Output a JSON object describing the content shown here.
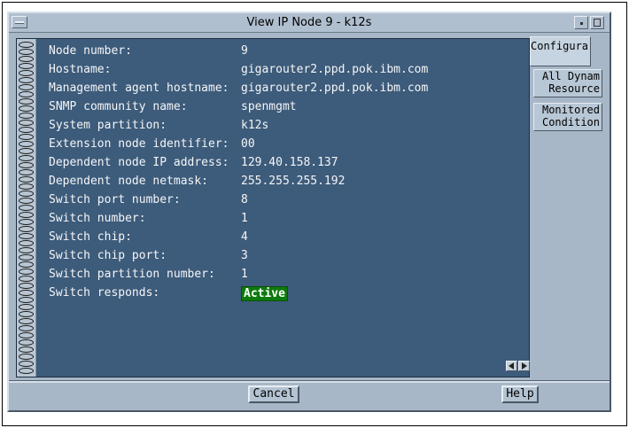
{
  "window": {
    "title": "View IP Node 9 - k12s"
  },
  "fields": [
    {
      "label": "Node number:",
      "value": "9"
    },
    {
      "label": "Hostname:",
      "value": "gigarouter2.ppd.pok.ibm.com"
    },
    {
      "label": "Management agent hostname:",
      "value": "gigarouter2.ppd.pok.ibm.com"
    },
    {
      "label": "SNMP community name:",
      "value": "spenmgmt"
    },
    {
      "label": "System partition:",
      "value": "k12s"
    },
    {
      "label": "Extension node identifier:",
      "value": "00"
    },
    {
      "label": "Dependent node IP address:",
      "value": "129.40.158.137"
    },
    {
      "label": "Dependent node netmask:",
      "value": "255.255.255.192"
    },
    {
      "label": "Switch port number:",
      "value": "8"
    },
    {
      "label": "Switch number:",
      "value": "1"
    },
    {
      "label": "Switch chip:",
      "value": "4"
    },
    {
      "label": "Switch chip port:",
      "value": "3"
    },
    {
      "label": "Switch partition number:",
      "value": "1"
    },
    {
      "label": "Switch responds:",
      "value": "Active"
    }
  ],
  "status_colors": {
    "active_bg": "#0c7a0c",
    "active_fg": "#ffffff"
  },
  "tabs": [
    {
      "line1": "Configura",
      "line2": ""
    },
    {
      "line1": "All Dynam",
      "line2": "Resource"
    },
    {
      "line1": "Monitored",
      "line2": "Condition"
    }
  ],
  "buttons": {
    "cancel": "Cancel",
    "help": "Help"
  },
  "icons": [
    "system-menu-icon",
    "minimize-icon",
    "maximize-icon",
    "page-back-icon",
    "page-forward-icon",
    "spiral-binding-icon"
  ]
}
